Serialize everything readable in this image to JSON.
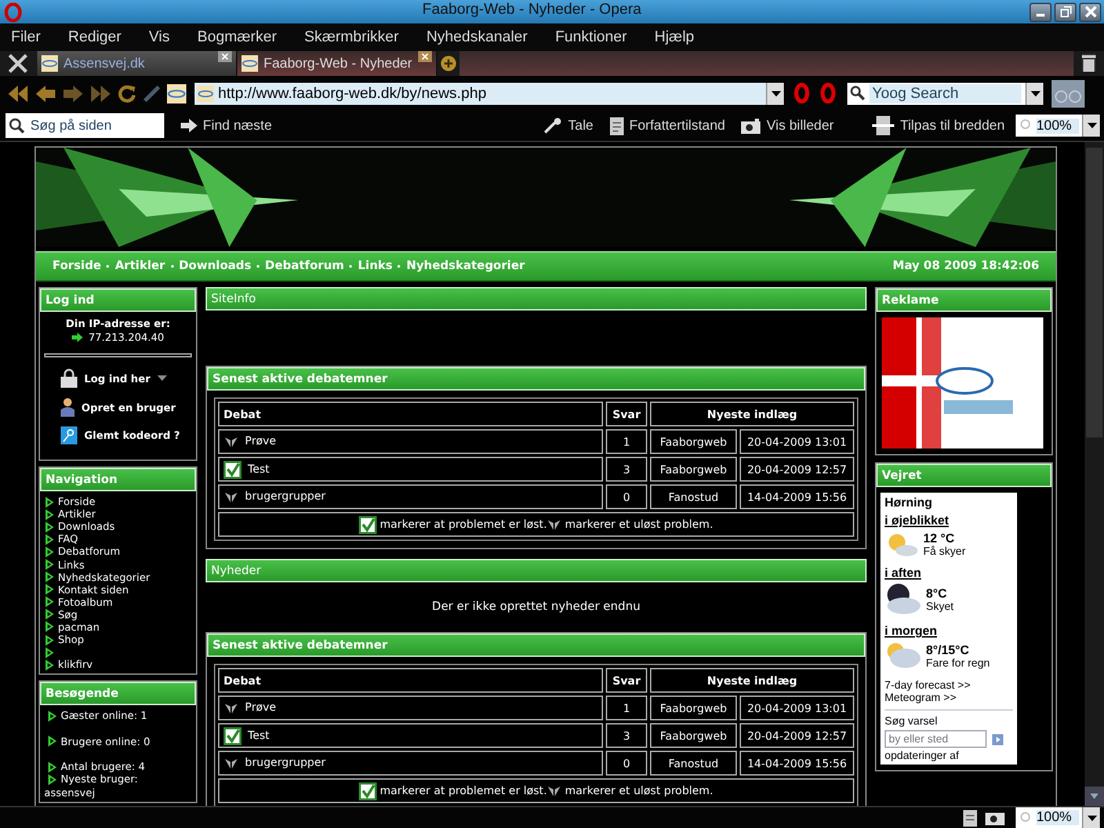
{
  "window": {
    "title": "Faaborg-Web - Nyheder - Opera"
  },
  "menu": [
    "Filer",
    "Rediger",
    "Vis",
    "Bogmærker",
    "Skærmbrikker",
    "Nyhedskanaler",
    "Funktioner",
    "Hjælp"
  ],
  "tabs": [
    {
      "label": "Assensvej.dk",
      "selected": false
    },
    {
      "label": "Faaborg-Web - Nyheder",
      "selected": true
    }
  ],
  "address": {
    "value": "http://www.faaborg-web.dk/by/news.php"
  },
  "search": {
    "placeholder": "Yoog Search"
  },
  "find": {
    "placeholder": "Søg på siden",
    "next": "Find næste"
  },
  "tools": [
    {
      "label": "Tale",
      "kind": "mic"
    },
    {
      "label": "Forfattertilstand",
      "kind": "doc"
    },
    {
      "label": "Vis billeder",
      "kind": "camera"
    },
    {
      "label": "Tilpas til bredden",
      "kind": "fit"
    }
  ],
  "zoom": "100%",
  "site": {
    "nav": [
      "Forside",
      "Artikler",
      "Downloads",
      "Debatforum",
      "Links",
      "Nyhedskategorier"
    ],
    "date": "May 08 2009 18:42:06"
  },
  "login": {
    "title": "Log ind",
    "ip_label": "Din IP-adresse er:",
    "ip": "77.213.204.40",
    "links": [
      {
        "label": "Log ind her",
        "kind": "lock"
      },
      {
        "label": "Opret en bruger",
        "kind": "user"
      },
      {
        "label": "Glemt kodeord ?",
        "kind": "key"
      }
    ]
  },
  "navigation": {
    "title": "Navigation",
    "items": [
      {
        "kind": "link",
        "label": "Forside"
      },
      {
        "kind": "link",
        "label": "Artikler"
      },
      {
        "kind": "link",
        "label": "Downloads"
      },
      {
        "kind": "link",
        "label": "FAQ"
      },
      {
        "kind": "link",
        "label": "Debatforum"
      },
      {
        "kind": "link",
        "label": "Links"
      },
      {
        "kind": "link",
        "label": "Nyhedskategorier"
      },
      {
        "kind": "link",
        "label": "Kontakt siden"
      },
      {
        "kind": "link",
        "label": "Fotoalbum"
      },
      {
        "kind": "link",
        "label": "Søg"
      },
      {
        "kind": "link",
        "label": "pacman"
      },
      {
        "kind": "link",
        "label": "Shop"
      },
      {
        "kind": "blank"
      },
      {
        "kind": "link",
        "label": "klikfirv"
      }
    ]
  },
  "visitors": {
    "title": "Besøgende",
    "groups": [
      [
        "Gæster online: 1"
      ],
      [
        "Brugere online: 0"
      ],
      [
        "Antal brugere: 4",
        "Nyeste bruger:"
      ]
    ],
    "newest_user": "assensvej"
  },
  "center": [
    {
      "kind": "info",
      "title": "SiteInfo"
    },
    {
      "kind": "forum",
      "title": "Senest aktive debatemner",
      "columns": [
        "Debat",
        "Svar",
        "Nyeste indlæg"
      ],
      "rows": [
        {
          "topic": "Prøve",
          "solved": false,
          "replies": "1",
          "author": "Faaborgweb",
          "date": "20-04-2009 13:01"
        },
        {
          "topic": "Test",
          "solved": true,
          "replies": "3",
          "author": "Faaborgweb",
          "date": "20-04-2009 12:57"
        },
        {
          "topic": "brugergrupper",
          "solved": false,
          "replies": "0",
          "author": "Fanostud",
          "date": "14-04-2009 15:56"
        }
      ],
      "legend_solved": "markerer at problemet er løst.",
      "legend_unsolved": "markerer et uløst problem."
    },
    {
      "kind": "news",
      "title": "Nyheder",
      "message": "Der er ikke oprettet nyheder endnu"
    },
    {
      "kind": "forum",
      "title": "Senest aktive debatemner",
      "columns": [
        "Debat",
        "Svar",
        "Nyeste indlæg"
      ],
      "rows": [
        {
          "topic": "Prøve",
          "solved": false,
          "replies": "1",
          "author": "Faaborgweb",
          "date": "20-04-2009 13:01"
        },
        {
          "topic": "Test",
          "solved": true,
          "replies": "3",
          "author": "Faaborgweb",
          "date": "20-04-2009 12:57"
        },
        {
          "topic": "brugergrupper",
          "solved": false,
          "replies": "0",
          "author": "Fanostud",
          "date": "14-04-2009 15:56"
        }
      ],
      "legend_solved": "markerer at problemet er løst.",
      "legend_unsolved": "markerer et uløst problem."
    }
  ],
  "ads": {
    "title": "Reklame",
    "kind": "picture"
  },
  "weather": {
    "title": "Vejret",
    "city": "Hørning",
    "periods": [
      {
        "label": "i øjeblikket",
        "temp": "12 °C",
        "desc": "Få skyer",
        "kind": "sun"
      },
      {
        "label": "i aften",
        "temp": "8°C",
        "desc": "Skyet",
        "kind": "night"
      },
      {
        "label": "i morgen",
        "temp": "8°/15°C",
        "desc": "Fare for regn",
        "kind": "cloud"
      }
    ],
    "links": [
      "7-day forecast >>",
      "Meteogram >>"
    ],
    "search_label": "Søg varsel",
    "search_placeholder": "by eller sted",
    "footer": "opdateringer af"
  },
  "status": {
    "zoom": "100%"
  }
}
